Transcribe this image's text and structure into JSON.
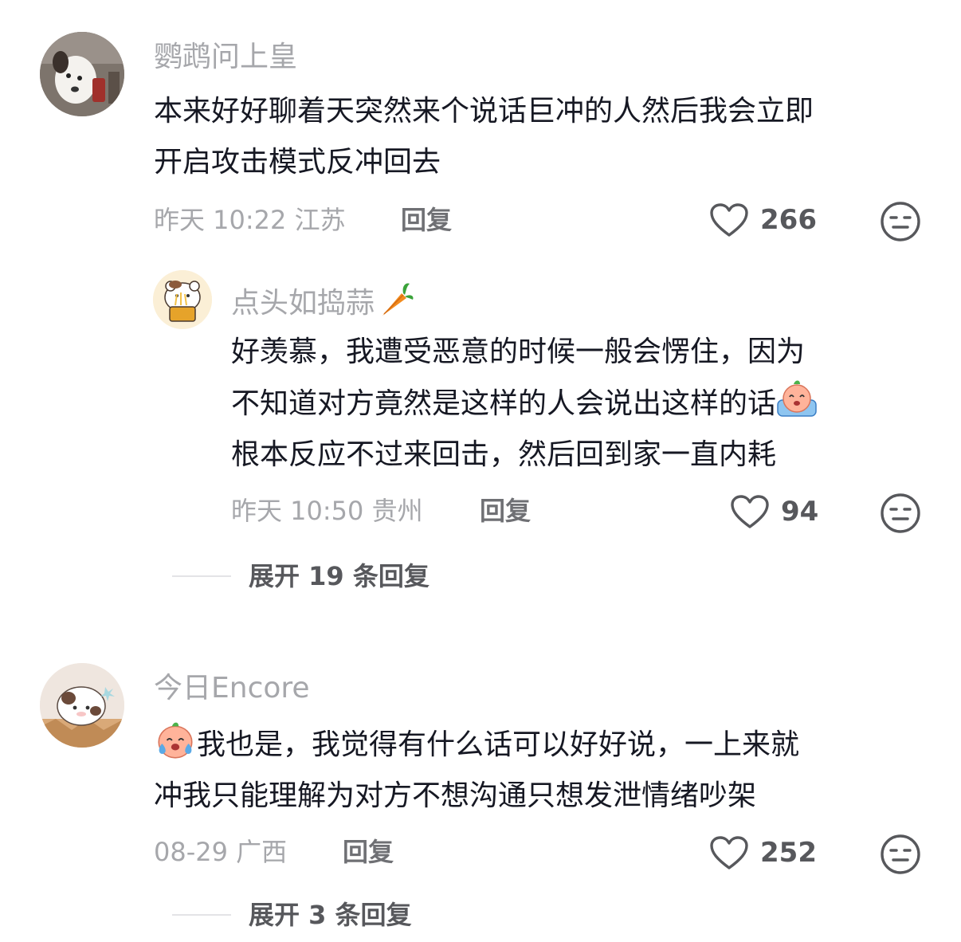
{
  "comments": [
    {
      "username": "鹦鹉问上皇",
      "text_line1": "本来好好聊着天突然来个说话巨冲的人然后我会立即",
      "text_line2": "开启攻击模式反冲回去",
      "meta": "昨天 10:22 江苏",
      "reply_label": "回复",
      "likes": "266",
      "replies": [
        {
          "username": "点头如捣蒜",
          "username_emoji": "carrot-emoji",
          "text_line1": "好羡慕，我遭受恶意的时候一般会愣住，因为",
          "text_line2": "不知道对方竟然是这样的人会说出这样的话",
          "text_line2_emoji": "crying-peach-emoji",
          "text_line3": "根本反应不过来回击，然后回到家一直内耗",
          "meta": "昨天 10:50 贵州",
          "reply_label": "回复",
          "likes": "94"
        }
      ],
      "expand_label": "展开 19 条回复"
    },
    {
      "username": "今日Encore",
      "text_emoji": "crying-peach-emoji",
      "text_line1": "我也是，我觉得有什么话可以好好说，一上来就",
      "text_line2": "冲我只能理解为对方不想沟通只想发泄情绪吵架",
      "meta": "08-29 广西",
      "reply_label": "回复",
      "likes": "252",
      "expand_label": "展开 3 条回复"
    }
  ],
  "colors": {
    "text": "#161823",
    "muted": "#a6a7ab",
    "action": "#57585c"
  }
}
